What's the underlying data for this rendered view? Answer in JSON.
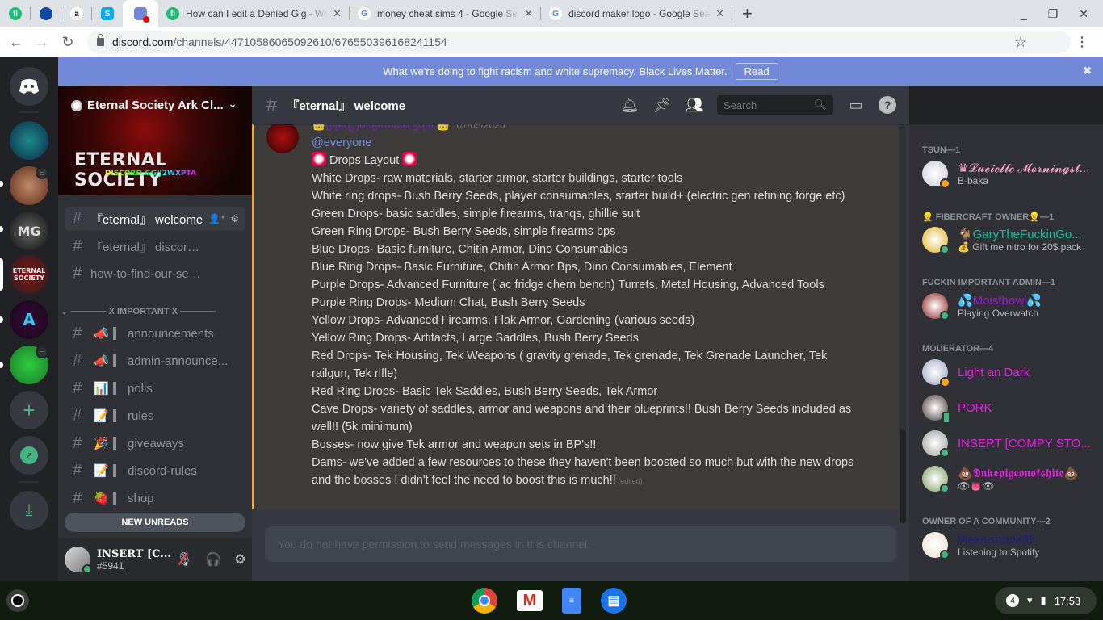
{
  "browser": {
    "pinned_tabs": [
      {
        "icon": "fiverr-icon",
        "glyph": "fi",
        "color": "#1dbf73"
      },
      {
        "icon": "blue-circle-icon",
        "glyph": "",
        "color": "#0d47a1"
      },
      {
        "icon": "amazon-icon",
        "glyph": "a",
        "color": "#ffffff"
      },
      {
        "icon": "skype-icon",
        "glyph": "S",
        "color": "#00aff0"
      },
      {
        "icon": "discord-icon",
        "glyph": "",
        "color": "#7289da"
      }
    ],
    "tabs": [
      {
        "title": "How can I edit a Denied Gig - We",
        "icon": "fiverr-icon"
      },
      {
        "title": "money cheat sims 4 - Google Se",
        "icon": "google-icon"
      },
      {
        "title": "discord maker logo - Google Sea",
        "icon": "google-icon"
      }
    ],
    "url_host": "discord.com",
    "url_path": "/channels/447105860650926​10/676550396168241154"
  },
  "banner": {
    "text": "What we're doing to fight racism and white supremacy. Black Lives Matter.",
    "button": "Read"
  },
  "server": {
    "name": "Eternal Society Ark Cl...",
    "banner_title": "ETERNAL SOCIETY",
    "banner_invite": "DISCORD.GG/J2WXPTA"
  },
  "channels_top": [
    {
      "name": "『eternal』 welcome",
      "selected": true
    },
    {
      "name": "『eternal』 discord-link"
    },
    {
      "name": "how-to-find-our-servers"
    }
  ],
  "category": "———— X IMPORTANT X ————",
  "channels_important": [
    {
      "emoji": "📣",
      "name": "announcements"
    },
    {
      "emoji": "📣",
      "name": "admin-announce..."
    },
    {
      "emoji": "📊",
      "name": "polls"
    },
    {
      "emoji": "📝",
      "name": "rules"
    },
    {
      "emoji": "🎉",
      "name": "giveaways"
    },
    {
      "emoji": "📝",
      "name": "discord-rules"
    },
    {
      "emoji": "🍓",
      "name": "shop"
    }
  ],
  "new_unreads": "NEW UNREADS",
  "user": {
    "name": "INSERT [C...",
    "tag": "#5941"
  },
  "channel_header": {
    "title": "『eternal』 welcome",
    "search_placeholder": "Search"
  },
  "message": {
    "author": "👑ɮɨ[ʀɖ] ʄʊƈӄɨռɢʍɛʟɮɖǟɛ👑",
    "timestamp": "07/05/2020",
    "mention": "@everyone",
    "heading": "Drops Layout",
    "lines": [
      "White Drops- raw materials, starter armor, starter buildings, starter tools",
      "White ring drops- Bush Berry Seeds, player consumables, starter build+ (electric gen refining forge etc)",
      "Green Drops- basic saddles, simple firearms, tranqs, ghillie suit",
      "Green Ring Drops- Bush Berry Seeds, simple firearms bps",
      "Blue Drops- Basic furniture, Chitin Armor, Dino Consumables",
      "Blue Ring Drops- Basic Furniture, Chitin Armor Bps, Dino Consumables, Element",
      "Purple Drops- Advanced Furniture ( ac fridge chem bench) Turrets, Metal Housing, Advanced Tools",
      "Purple Ring Drops- Medium Chat, Bush Berry Seeds",
      "Yellow Drops- Advanced Firearms, Flak Armor, Gardening (various seeds)",
      "Yellow Ring Drops- Artifacts, Large Saddles, Bush Berry Seeds",
      "Red Drops- Tek Housing, Tek Weapons ( gravity grenade, Tek grenade, Tek Grenade Launcher, Tek railgun, Tek rifle)",
      "Red Ring Drops- Basic Tek Saddles, Bush Berry Seeds, Tek Armor",
      "Cave Drops- variety of saddles, armor and weapons and their blueprints!! Bush Berry Seeds included as well!! (5k minimum)",
      "Bosses- now give Tek armor and weapon sets in BP's!!",
      "Dams- we've added a few resources to these they haven't been boosted so much but with the new drops and the bosses I didn't feel the need to boost this is much!!"
    ],
    "edited": "(edited)"
  },
  "composer_placeholder": "You do not have permission to send messages in this channel.",
  "members": {
    "groups": [
      {
        "label": "TSUN—1",
        "members": [
          {
            "name": "♛𝓛𝓾𝓬𝓲𝓮𝓵𝓵𝓮 𝓜𝓸𝓻𝓷𝓲𝓷𝓰𝓼𝓽...",
            "status": "B-baka",
            "color": "#f5a3c7",
            "presence": "idle"
          }
        ]
      },
      {
        "label": "👷 FIBERCRAFT OWNER👷—1",
        "members": [
          {
            "name": "🐐GaryTheFuckinGo...",
            "status": "💰 Gift me nitro for 20$ pack",
            "color": "#1abc9c",
            "presence": "online"
          }
        ]
      },
      {
        "label": "FUCKIN IMPORTANT ADMIN—1",
        "members": [
          {
            "name": "💦Moistbowl💦",
            "status": "Playing Overwatch",
            "color": "#9b19d6",
            "presence": "online"
          }
        ]
      },
      {
        "label": "MODERATOR—4",
        "members": [
          {
            "name": "Light an Dark",
            "status": "",
            "color": "#e91ee3",
            "presence": "idle"
          },
          {
            "name": "PORK",
            "status": "",
            "color": "#e91ee3",
            "presence": "mobile"
          },
          {
            "name": "INSERT [COMPY STO...",
            "status": "",
            "color": "#e91ee3",
            "presence": "online"
          },
          {
            "name": "💩𝕯𝖚𝖐𝖊𝖕𝖎𝖌𝖊𝖔𝖓𝖔𝖋𝖘𝖍𝖎𝖙𝖊💩",
            "status": "👁👅👁",
            "color": "#e91ee3",
            "presence": "online"
          }
        ]
      },
      {
        "label": "OWNER OF A COMMUNITY—2",
        "members": [
          {
            "name": "Maxisshook69",
            "status": "Listening to Spotify",
            "color": "#1f1b8a",
            "presence": "online"
          }
        ]
      }
    ]
  },
  "taskbar": {
    "apps": [
      "chrome-icon",
      "gmail-icon",
      "docs-icon",
      "messages-icon"
    ],
    "notifications": "4",
    "time": "17:53"
  },
  "colors": {
    "blurple": "#7289da",
    "online": "#43b581",
    "idle": "#faa61a",
    "mention_bar": "#faa61a"
  }
}
